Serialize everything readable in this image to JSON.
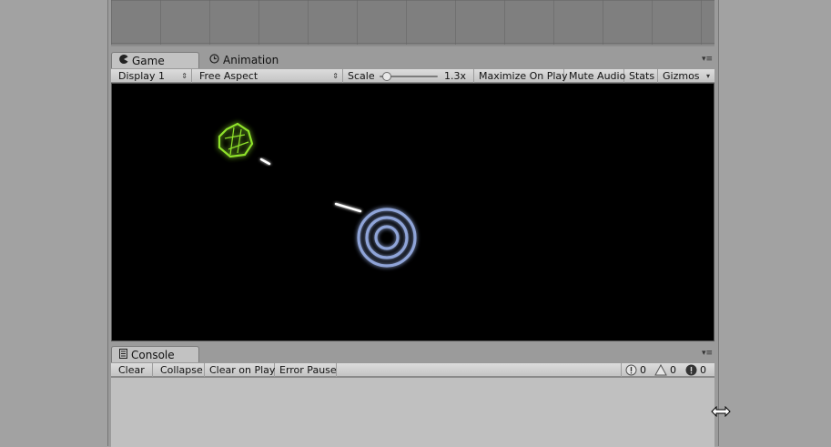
{
  "game_panel": {
    "tabs": [
      {
        "label": "Game",
        "icon": "pacman-icon",
        "active": true
      },
      {
        "label": "Animation",
        "icon": "clock-icon",
        "active": false
      }
    ],
    "toolbar": {
      "display": "Display 1",
      "aspect": "Free Aspect",
      "scale_label": "Scale",
      "scale_value": "1.3x",
      "scale_fraction": 0.12,
      "maximize_on_play": "Maximize On Play",
      "mute_audio": "Mute Audio",
      "stats": "Stats",
      "gizmos": "Gizmos"
    },
    "colors": {
      "asteroid": "#8fe22a",
      "rings": "#8fa4d8",
      "bullet": "#ffffff"
    }
  },
  "console_panel": {
    "tab": {
      "label": "Console",
      "icon": "console-icon"
    },
    "toolbar": {
      "clear": "Clear",
      "collapse": "Collapse",
      "clear_on_play": "Clear on Play",
      "error_pause": "Error Pause"
    },
    "counts": {
      "info": "0",
      "warning": "0",
      "error": "0"
    }
  }
}
